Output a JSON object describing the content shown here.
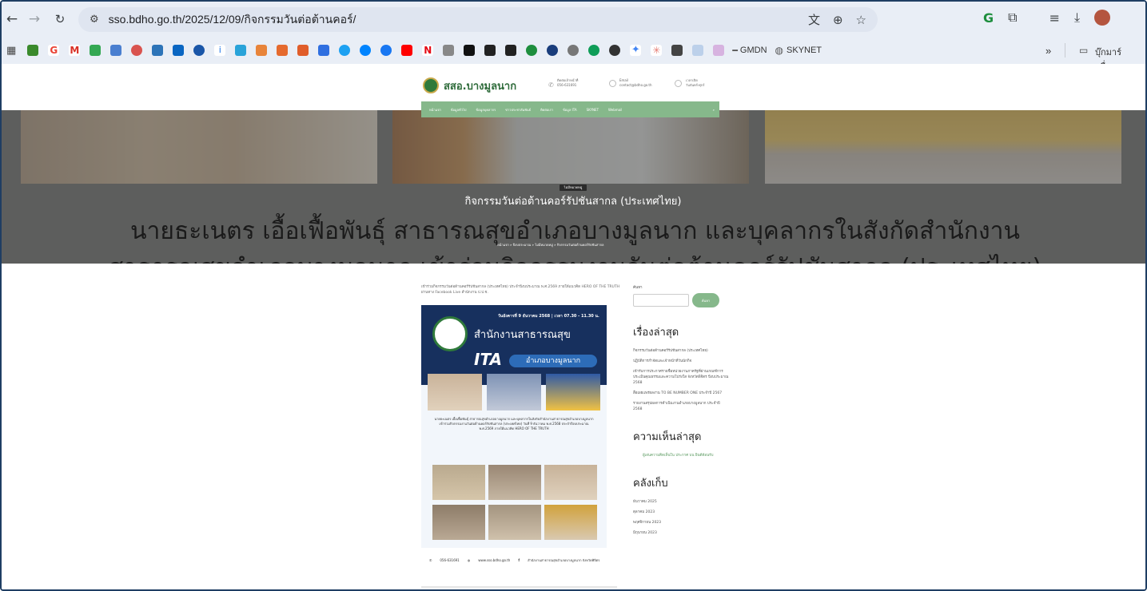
{
  "browser": {
    "url": "sso.bdho.go.th/2025/12/09/กิจกรรมวันต่อต้านคอร์/",
    "bookmarks_labels": [
      "GMDN",
      "SKYNET"
    ],
    "overflow_label": "»",
    "folder_label": "บุ๊กมาร์กอื่นๆ"
  },
  "site": {
    "name": "สสอ.บางมูลนาก",
    "phone_label": "ติดต่อเจ้าหน้าที่",
    "phone": "056-631691",
    "email_label": "Email",
    "email": "contact@bdho.go.th",
    "hours_label": "เวลาเปิด",
    "hours": "วันจันทร์-ศุกร์",
    "nav": [
      "หน้าแรก",
      "ข้อมูลทั่วไป",
      "ข้อมูลบุคลากร",
      "ข่าวประชาสัมพันธ์",
      "ติดต่อเรา",
      "ข้อมูล ITA",
      "SKYNET",
      "Webmail"
    ]
  },
  "hero": {
    "category": "ไม่มีหมวดหมู่",
    "title": "กิจกรรมวันต่อต้านคอร์รัปชันสากล (ประเทศไทย)",
    "big_line_1": "นายธะเนตร เอื้อเฟื้อพันธุ์ สาธารณสุขอำเภอบางมูลนาก และบุคลากรในสังกัดสำนักงาน",
    "big_line_2": "สาธารณสุขอำเภอบางมูลนาก เข้าร่วมกิจกรรมงานวันต่อต้านคอร์รัปชันสากล (ประเทศไทย)",
    "breadcrumb": "หน้าแรก  »  ปีงบประมาณ  »  ไม่มีหมวดหมู่  »  กิจกรรมวันต่อต้านคอร์รัปชันสากล"
  },
  "article": {
    "intro": "เข้าร่วมกิจกรรมวันต่อต้านคอร์รัปชันสากล (ประเทศไทย) ประจำปีงบประมาณ พ.ศ.2569 ภายใต้แนวคิด HERO OF THE TRUTH ผ่านทาง Facebook Live สำนักงาน ป.ป.ช.",
    "poster": {
      "date_line": "วันอังคารที่ 9 ธันวาคม 2568 | เวลา 07.30 - 11.30 น.",
      "org_line1": "สำนักงานสาธารณสุข",
      "org_line2": "อำเภอบางมูลนาก",
      "ita": "ITA",
      "body": "นายธะเนตร เอื้อเฟื้อพันธุ์ สาธารณสุขอำเภอบางมูลนาก และบุคลากรในสังกัดสำนักงานสาธารณสุขอำเภอบางมูลนาก เข้าร่วมกิจกรรมงานวันต่อต้านคอร์รัปชันสากล (ประเทศไทย) วันที่ 9 ธันวาคม พ.ศ.2568 ประจำปีงบประมาณ พ.ศ.2569 ภายใต้แนวคิด HERO OF THE TRUTH"
    },
    "contact_phone": "056-631691",
    "contact_web": "www.sso.bdho.go.th",
    "contact_fb": "สำนักงานสาธารณสุขอำเภอบางมูลนาก จังหวัดพิจิตร"
  },
  "sidebar": {
    "search_label": "ค้นหา",
    "search_button": "ค้นหา",
    "recent_title": "เรื่องล่าสุด",
    "recent": [
      "กิจกรรมวันต่อต้านคอร์รัปชันสากล (ประเทศไทย)",
      "ปฏิบัติการกำจัดและเจ้าหน้าที่วันนักกิจ",
      "เข้ารับการประกาศรายชื่อหน่วยงานภาครัฐที่ผ่านเกณฑ์การประเมินคุณธรรมและความโปร่งใส จังหวัดพิจิตร ปีงบประมาณ 2568",
      "สื่อเผยแพร่ผลงาน TO BE NUMBER ONE ประจำปี 2567",
      "รายงานสรุปผลการดำเนินงานอำเภอบางมูลนาก ประจำปี 2568"
    ],
    "comments_title": "ความเห็นล่าสุด",
    "comment": "ผู้เล่นความคิดเห็นใน ประกาศ บน ยินดีต้อนรับ",
    "archive_title": "คลังเก็บ",
    "archive": [
      "ธันวาคม 2025",
      "ตุลาคม 2023",
      "พฤศจิกายน 2023",
      "มิถุนายน 2023"
    ]
  },
  "colors": {
    "site_green": "#86b88b",
    "poster_navy": "#17305e"
  }
}
